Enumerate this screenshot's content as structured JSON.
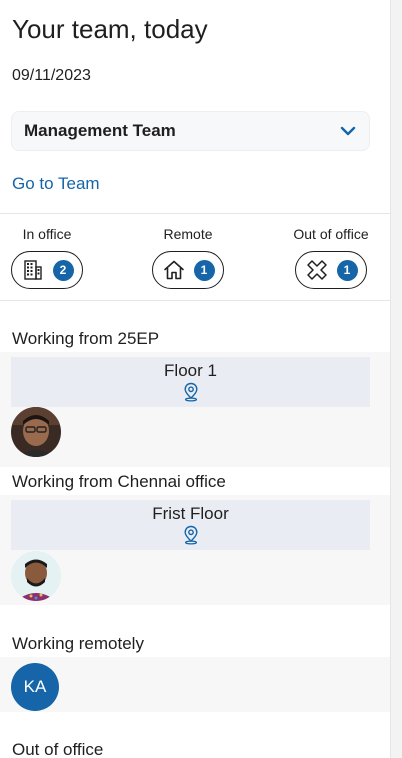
{
  "header": {
    "title": "Your team, today",
    "date": "09/11/2023"
  },
  "team_select": {
    "selected": "Management Team"
  },
  "links": {
    "go_to_team": "Go to Team"
  },
  "stats": [
    {
      "label": "In office",
      "count": "2",
      "icon": "building-icon"
    },
    {
      "label": "Remote",
      "count": "1",
      "icon": "home-icon"
    },
    {
      "label": "Out of office",
      "count": "1",
      "icon": "cross-icon"
    }
  ],
  "sections": {
    "office1": {
      "title": "Working from 25EP",
      "floor": "Floor 1"
    },
    "office2": {
      "title": "Working from Chennai office",
      "floor": "Frist Floor"
    },
    "remote": {
      "title": "Working remotely",
      "initials": "KA"
    },
    "ooo": {
      "title": "Out of office"
    }
  },
  "colors": {
    "accent": "#1565a8",
    "floor_box": "#e9edf3",
    "section_bg": "#f7f7f8"
  }
}
